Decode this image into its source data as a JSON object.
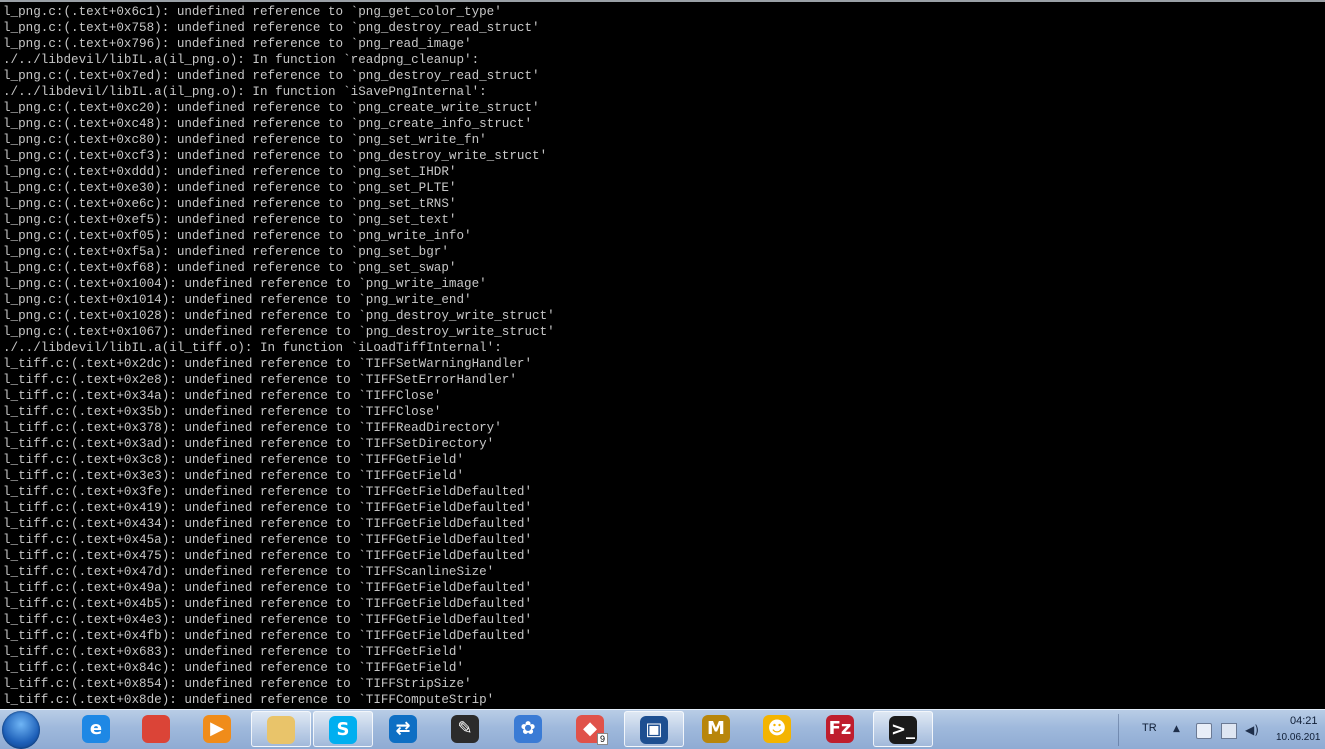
{
  "console": {
    "lines": [
      "l_png.c:(.text+0x6c1): undefined reference to `png_get_color_type'",
      "l_png.c:(.text+0x758): undefined reference to `png_destroy_read_struct'",
      "l_png.c:(.text+0x796): undefined reference to `png_read_image'",
      "./../libdevil/libIL.a(il_png.o): In function `readpng_cleanup':",
      "l_png.c:(.text+0x7ed): undefined reference to `png_destroy_read_struct'",
      "./../libdevil/libIL.a(il_png.o): In function `iSavePngInternal':",
      "l_png.c:(.text+0xc20): undefined reference to `png_create_write_struct'",
      "l_png.c:(.text+0xc48): undefined reference to `png_create_info_struct'",
      "l_png.c:(.text+0xc80): undefined reference to `png_set_write_fn'",
      "l_png.c:(.text+0xcf3): undefined reference to `png_destroy_write_struct'",
      "l_png.c:(.text+0xddd): undefined reference to `png_set_IHDR'",
      "l_png.c:(.text+0xe30): undefined reference to `png_set_PLTE'",
      "l_png.c:(.text+0xe6c): undefined reference to `png_set_tRNS'",
      "l_png.c:(.text+0xef5): undefined reference to `png_set_text'",
      "l_png.c:(.text+0xf05): undefined reference to `png_write_info'",
      "l_png.c:(.text+0xf5a): undefined reference to `png_set_bgr'",
      "l_png.c:(.text+0xf68): undefined reference to `png_set_swap'",
      "l_png.c:(.text+0x1004): undefined reference to `png_write_image'",
      "l_png.c:(.text+0x1014): undefined reference to `png_write_end'",
      "l_png.c:(.text+0x1028): undefined reference to `png_destroy_write_struct'",
      "l_png.c:(.text+0x1067): undefined reference to `png_destroy_write_struct'",
      "./../libdevil/libIL.a(il_tiff.o): In function `iLoadTiffInternal':",
      "l_tiff.c:(.text+0x2dc): undefined reference to `TIFFSetWarningHandler'",
      "l_tiff.c:(.text+0x2e8): undefined reference to `TIFFSetErrorHandler'",
      "l_tiff.c:(.text+0x34a): undefined reference to `TIFFClose'",
      "l_tiff.c:(.text+0x35b): undefined reference to `TIFFClose'",
      "l_tiff.c:(.text+0x378): undefined reference to `TIFFReadDirectory'",
      "l_tiff.c:(.text+0x3ad): undefined reference to `TIFFSetDirectory'",
      "l_tiff.c:(.text+0x3c8): undefined reference to `TIFFGetField'",
      "l_tiff.c:(.text+0x3e3): undefined reference to `TIFFGetField'",
      "l_tiff.c:(.text+0x3fe): undefined reference to `TIFFGetFieldDefaulted'",
      "l_tiff.c:(.text+0x419): undefined reference to `TIFFGetFieldDefaulted'",
      "l_tiff.c:(.text+0x434): undefined reference to `TIFFGetFieldDefaulted'",
      "l_tiff.c:(.text+0x45a): undefined reference to `TIFFGetFieldDefaulted'",
      "l_tiff.c:(.text+0x475): undefined reference to `TIFFGetFieldDefaulted'",
      "l_tiff.c:(.text+0x47d): undefined reference to `TIFFScanlineSize'",
      "l_tiff.c:(.text+0x49a): undefined reference to `TIFFGetFieldDefaulted'",
      "l_tiff.c:(.text+0x4b5): undefined reference to `TIFFGetFieldDefaulted'",
      "l_tiff.c:(.text+0x4e3): undefined reference to `TIFFGetFieldDefaulted'",
      "l_tiff.c:(.text+0x4fb): undefined reference to `TIFFGetFieldDefaulted'",
      "l_tiff.c:(.text+0x683): undefined reference to `TIFFGetField'",
      "l_tiff.c:(.text+0x84c): undefined reference to `TIFFGetField'",
      "l_tiff.c:(.text+0x854): undefined reference to `TIFFStripSize'",
      "l_tiff.c:(.text+0x8de): undefined reference to `TIFFComputeStrip'"
    ]
  },
  "taskbar": {
    "apps": [
      {
        "name": "internet-explorer-icon",
        "glyph": "e",
        "color": "#1e88e5",
        "active": false
      },
      {
        "name": "chrome-icon",
        "glyph": "",
        "color": "#db4437",
        "active": false
      },
      {
        "name": "media-player-icon",
        "glyph": "▶",
        "color": "#f08c1a",
        "active": false
      },
      {
        "name": "explorer-folder-icon",
        "glyph": "",
        "color": "#e9c46a",
        "active": true
      },
      {
        "name": "skype-icon",
        "glyph": "S",
        "color": "#00aff0",
        "active": true
      },
      {
        "name": "teamviewer-icon",
        "glyph": "⇄",
        "color": "#0e6fc4",
        "active": false
      },
      {
        "name": "app-quill-icon",
        "glyph": "✎",
        "color": "#2b2b2b",
        "active": false
      },
      {
        "name": "app-swirl-icon",
        "glyph": "✿",
        "color": "#3a7bd5",
        "active": false
      },
      {
        "name": "app-gem-icon",
        "glyph": "◆",
        "color": "#e0524a",
        "active": false,
        "badge": "9"
      },
      {
        "name": "virtualbox-icon",
        "glyph": "▣",
        "color": "#1d4f91",
        "active": true
      },
      {
        "name": "app-mascot-icon",
        "glyph": "M",
        "color": "#b8860b",
        "active": false
      },
      {
        "name": "app-chat-icon",
        "glyph": "☻",
        "color": "#f4b400",
        "active": false
      },
      {
        "name": "filezilla-icon",
        "glyph": "Fz",
        "color": "#bf1e2e",
        "active": false
      },
      {
        "name": "command-prompt-icon",
        "glyph": ">_",
        "color": "#1a1a1a",
        "active": true
      }
    ],
    "tray": {
      "language": "TR",
      "time": "04:21",
      "date": "10.06.201"
    }
  }
}
